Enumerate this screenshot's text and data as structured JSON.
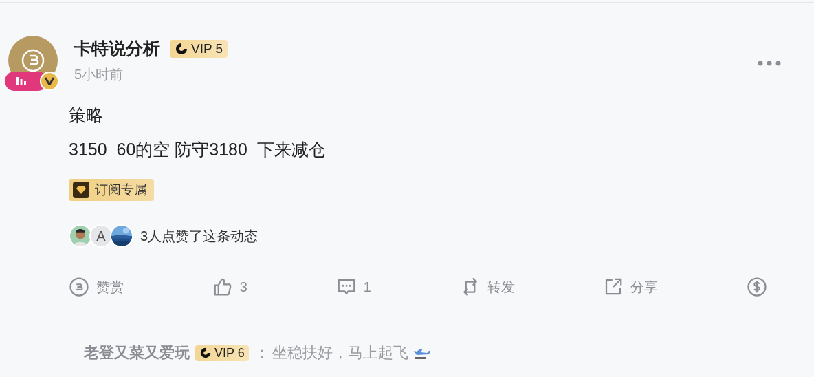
{
  "post": {
    "author": "卡特说分析",
    "vip": "VIP 5",
    "time": "5小时前",
    "lines": [
      "策略",
      "3150  60的空 防守3180  下来减仓"
    ],
    "tag": "订阅专属"
  },
  "likes": {
    "letter": "A",
    "text": "3人点赞了这条动态"
  },
  "actions": [
    {
      "kind": "tip",
      "label": "赞赏"
    },
    {
      "kind": "like",
      "label": "3"
    },
    {
      "kind": "comment",
      "label": "1"
    },
    {
      "kind": "repost",
      "label": "转发"
    },
    {
      "kind": "share",
      "label": "分享"
    },
    {
      "kind": "coin"
    }
  ],
  "comment": {
    "author": "老登又菜又爱玩",
    "vip": "VIP 6",
    "colon": "：",
    "text": "坐稳扶好，马上起飞"
  }
}
